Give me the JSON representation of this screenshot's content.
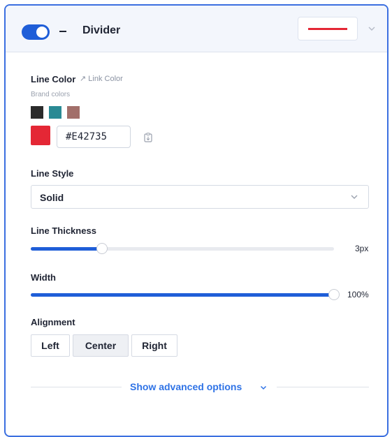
{
  "header": {
    "title": "Divider",
    "toggle_on": true,
    "preview_color": "#e42735"
  },
  "line_color": {
    "label": "Line Color",
    "link_label": "Link Color",
    "brand_label": "Brand colors",
    "brand_swatches": [
      "#2b2b2b",
      "#2a8a94",
      "#a26f6a"
    ],
    "current_color": "#E42735",
    "hex_value": "#E42735"
  },
  "line_style": {
    "label": "Line Style",
    "selected": "Solid"
  },
  "line_thickness": {
    "label": "Line Thickness",
    "value_text": "3px",
    "fraction": 0.235
  },
  "width": {
    "label": "Width",
    "value_text": "100%",
    "fraction": 1.0
  },
  "alignment": {
    "label": "Alignment",
    "options": [
      "Left",
      "Center",
      "Right"
    ],
    "selected": "Center"
  },
  "advanced": {
    "label": "Show advanced options"
  },
  "icons": {
    "link": "link-arrow-icon",
    "clipboard": "clipboard-icon",
    "chevron": "chevron-down-icon"
  }
}
